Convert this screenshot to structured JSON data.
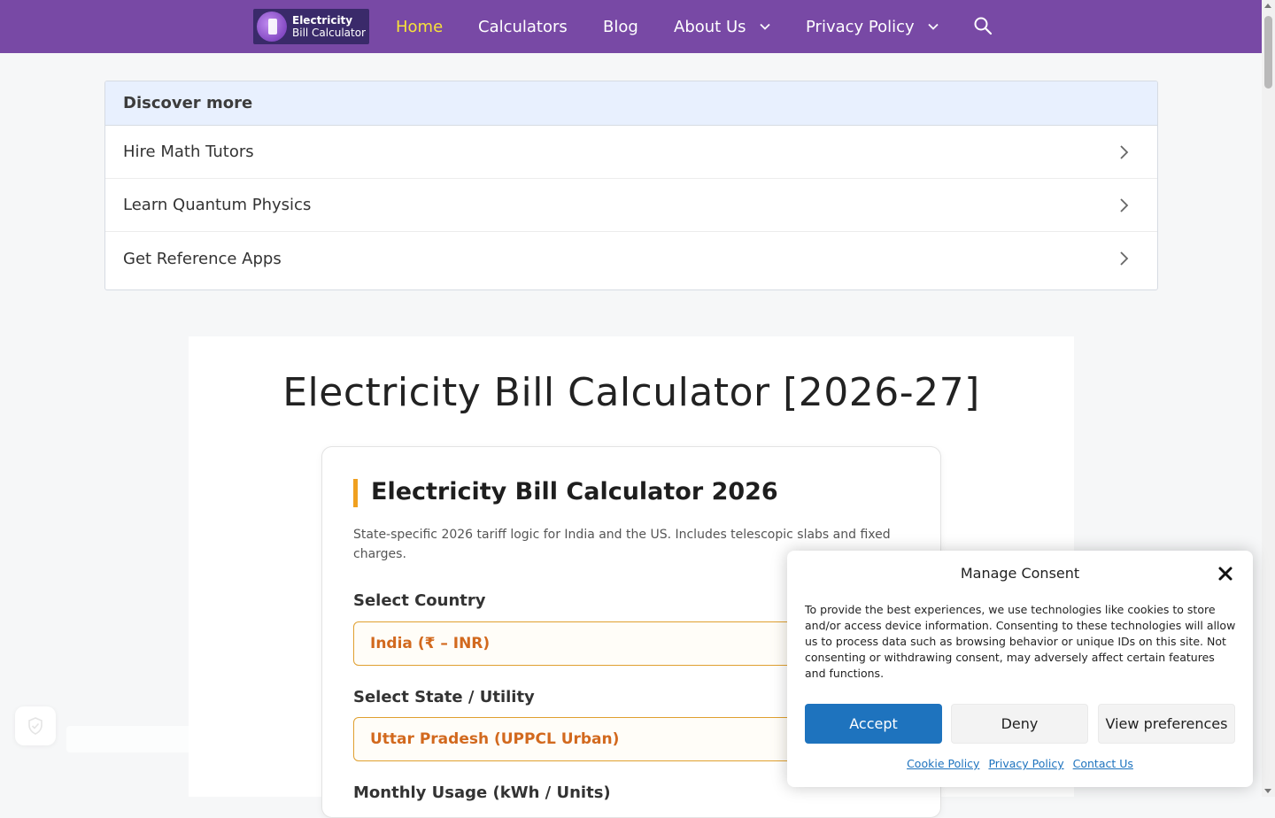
{
  "header": {
    "logo": {
      "line1": "Electricity",
      "line2": "Bill Calculator"
    },
    "nav": [
      {
        "label": "Home",
        "active": true
      },
      {
        "label": "Calculators"
      },
      {
        "label": "Blog"
      },
      {
        "label": "About Us",
        "has_dropdown": true
      },
      {
        "label": "Privacy Policy",
        "has_dropdown": true
      }
    ],
    "search_icon": "search-icon",
    "background_color": "#7849a5",
    "active_color": "#f7e23a"
  },
  "discover": {
    "heading": "Discover more",
    "items": [
      {
        "label": "Hire Math Tutors"
      },
      {
        "label": "Learn Quantum Physics"
      },
      {
        "label": "Get Reference Apps"
      }
    ]
  },
  "article": {
    "title": "Electricity Bill Calculator [2026-27]",
    "calculator": {
      "title": "Electricity Bill Calculator 2026",
      "description": "State-specific 2026 tariff logic for India and the US. Includes telescopic slabs and fixed charges.",
      "fields": [
        {
          "label": "Select Country",
          "value": "India (₹ – INR)"
        },
        {
          "label": "Select State / Utility",
          "value": "Uttar Pradesh (UPPCL Urban)"
        },
        {
          "label": "Monthly Usage (kWh / Units)"
        }
      ],
      "accent_color": "#f0a020",
      "value_color": "#d2691e"
    }
  },
  "consent": {
    "title": "Manage Consent",
    "text": "To provide the best experiences, we use technologies like cookies to store and/or access device information. Consenting to these technologies will allow us to process data such as browsing behavior or unique IDs on this site. Not consenting or withdrawing consent, may adversely affect certain features and functions.",
    "buttons": {
      "accept": "Accept",
      "deny": "Deny",
      "preferences": "View preferences"
    },
    "links": [
      "Cookie Policy",
      "Privacy Policy",
      "Contact Us"
    ],
    "accept_color": "#1e73be"
  }
}
